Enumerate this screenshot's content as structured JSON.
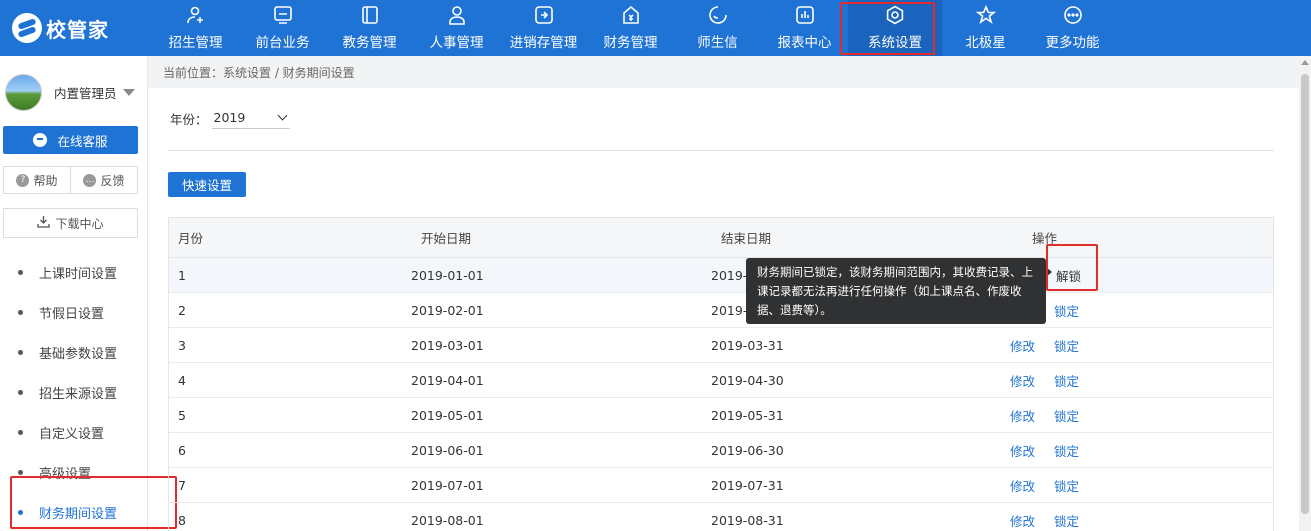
{
  "app": {
    "logo_text": "校管家"
  },
  "nav": [
    {
      "label": "招生管理",
      "icon": "user-add-icon"
    },
    {
      "label": "前台业务",
      "icon": "monitor-icon"
    },
    {
      "label": "教务管理",
      "icon": "book-icon"
    },
    {
      "label": "人事管理",
      "icon": "person-icon"
    },
    {
      "label": "进销存管理",
      "icon": "inventory-icon"
    },
    {
      "label": "财务管理",
      "icon": "finance-icon"
    },
    {
      "label": "师生信",
      "icon": "message-icon"
    },
    {
      "label": "报表中心",
      "icon": "report-icon"
    },
    {
      "label": "系统设置",
      "icon": "settings-icon"
    },
    {
      "label": "北极星",
      "icon": "star-icon"
    },
    {
      "label": "更多功能",
      "icon": "more-icon"
    }
  ],
  "sidebar": {
    "user_name": "内置管理员",
    "service_label": "在线客服",
    "help_label": "帮助",
    "feedback_label": "反馈",
    "download_label": "下载中心",
    "menu": [
      "上课时间设置",
      "节假日设置",
      "基础参数设置",
      "招生来源设置",
      "自定义设置",
      "高级设置",
      "财务期间设置"
    ]
  },
  "main": {
    "breadcrumb": "当前位置：系统设置 / 财务期间设置",
    "year_label": "年份：",
    "year_value": "2019",
    "quick_button": "快速设置",
    "columns": [
      "月份",
      "开始日期",
      "结束日期",
      "操作"
    ],
    "rows": [
      {
        "month": "1",
        "start": "2019-01-01",
        "end": "2019-0",
        "edit": "",
        "lock": "解锁"
      },
      {
        "month": "2",
        "start": "2019-02-01",
        "end": "2019-0",
        "edit": "",
        "lock": "锁定"
      },
      {
        "month": "3",
        "start": "2019-03-01",
        "end": "2019-03-31",
        "edit": "修改",
        "lock": "锁定"
      },
      {
        "month": "4",
        "start": "2019-04-01",
        "end": "2019-04-30",
        "edit": "修改",
        "lock": "锁定"
      },
      {
        "month": "5",
        "start": "2019-05-01",
        "end": "2019-05-31",
        "edit": "修改",
        "lock": "锁定"
      },
      {
        "month": "6",
        "start": "2019-06-01",
        "end": "2019-06-30",
        "edit": "修改",
        "lock": "锁定"
      },
      {
        "month": "7",
        "start": "2019-07-01",
        "end": "2019-07-31",
        "edit": "修改",
        "lock": "锁定"
      },
      {
        "month": "8",
        "start": "2019-08-01",
        "end": "2019-08-31",
        "edit": "修改",
        "lock": "锁定"
      }
    ],
    "tooltip": "财务期间已锁定，该财务期间范围内，其收费记录、上课记录都无法再进行任何操作（如上课点名、作废收据、退费等）。"
  },
  "colors": {
    "primary": "#1f73d4",
    "highlight_box": "#e32b2b",
    "tooltip_bg": "#303133"
  }
}
